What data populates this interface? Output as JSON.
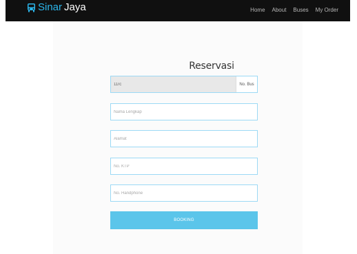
{
  "nav": {
    "brand_part1": "Sinar",
    "brand_part2": "Jaya",
    "links": [
      "Home",
      "About",
      "Buses",
      "My Order"
    ]
  },
  "form": {
    "title": "Reservasi",
    "bus_value": "11rc",
    "bus_addon": "No. Bus",
    "name_placeholder": "Nama Lengkap",
    "address_placeholder": "Alamat",
    "ktp_placeholder": "No. KTP",
    "phone_placeholder": "No. Handphone",
    "submit_label": "BOOKING"
  },
  "colors": {
    "navbar_bg": "#101010",
    "brand_accent": "#2bb5ea",
    "input_border": "#9bd9f5",
    "button_bg": "#5bc5ea"
  },
  "icons": {
    "brand": "bus-icon"
  }
}
